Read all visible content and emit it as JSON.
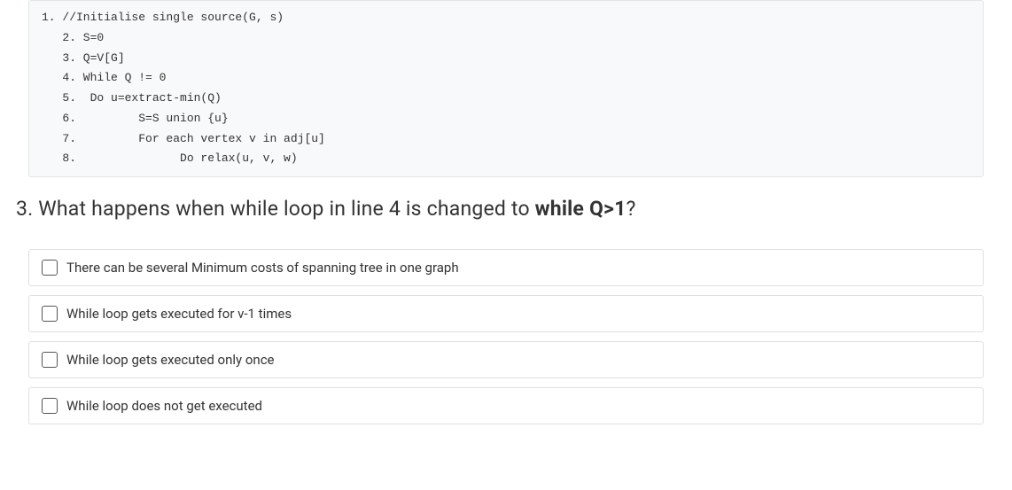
{
  "code": {
    "line1": "1. //Initialise single source(G, s)",
    "line2": "   2. S=0",
    "line3": "   3. Q=V[G]",
    "line4": "   4. While Q != 0",
    "line5": "   5.  Do u=extract-min(Q)",
    "line6": "   6.         S=S union {u}",
    "line7": "   7.         For each vertex v in adj[u]",
    "line8": "   8.               Do relax(u, v, w)"
  },
  "question": {
    "number": "3.",
    "text_before": " What happens when while loop in line 4 is changed to ",
    "bold_text": "while Q>1",
    "text_after": "?"
  },
  "options": {
    "opt1": "There can be several Minimum costs of spanning tree in one graph",
    "opt2": "While loop gets executed for v-1 times",
    "opt3": "While loop gets executed only once",
    "opt4": "While loop does not get executed"
  }
}
